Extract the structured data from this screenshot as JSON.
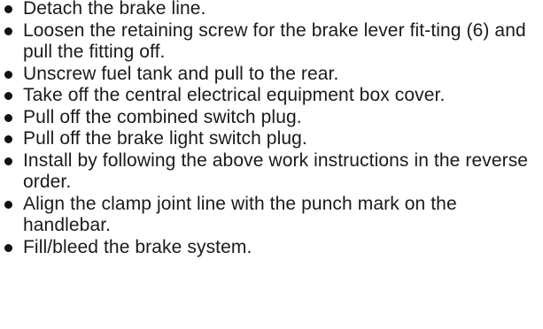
{
  "instructions": {
    "steps": [
      "Detach the brake line.",
      "Loosen the retaining screw for the brake lever fit-ting (6) and pull the fitting off.",
      "Unscrew fuel tank and pull to the rear.",
      "Take off the central electrical equipment box cover.",
      "Pull off the combined switch plug.",
      "Pull off the brake light switch plug.",
      "Install by following the above work instructions in the reverse order.",
      "Align the clamp joint line with the punch mark on the handlebar.",
      "Fill/bleed the brake system."
    ]
  }
}
